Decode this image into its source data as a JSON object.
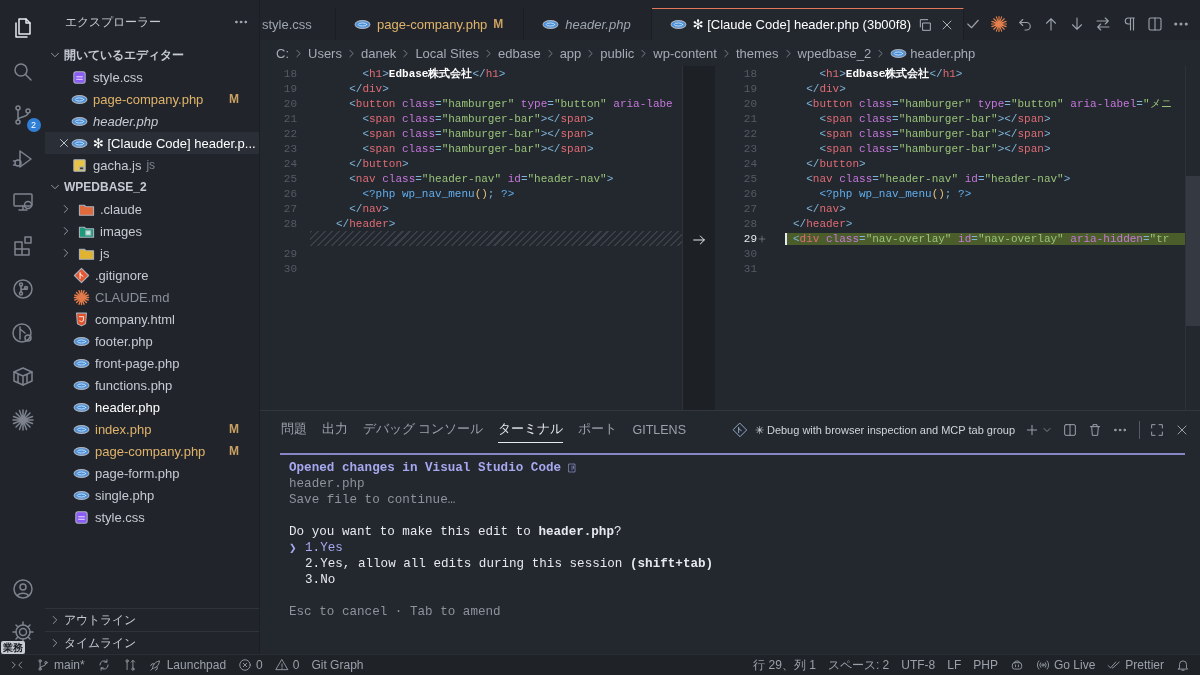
{
  "activity_bar": {
    "items": [
      {
        "kind": "explorer",
        "selected": true
      },
      {
        "kind": "search",
        "selected": false
      },
      {
        "kind": "source-control",
        "selected": false,
        "badge": "2"
      },
      {
        "kind": "run-debug",
        "selected": false
      },
      {
        "kind": "remote",
        "selected": false
      },
      {
        "kind": "extensions",
        "selected": false
      },
      {
        "kind": "git-graph",
        "selected": false
      },
      {
        "kind": "branch-search",
        "selected": false
      },
      {
        "kind": "container",
        "selected": false
      },
      {
        "kind": "claude",
        "selected": false
      }
    ],
    "bottom": [
      {
        "kind": "account",
        "selected": false
      },
      {
        "kind": "settings",
        "selected": false,
        "badge": "業務"
      }
    ]
  },
  "sidebar": {
    "title": "エクスプローラー",
    "sections": [
      {
        "title": "開いているエディター",
        "expanded": true,
        "items": [
          {
            "label": "style.css",
            "kind": "css",
            "selected": false
          },
          {
            "label": "page-company.php",
            "kind": "php",
            "selected": false,
            "modified": true,
            "badge": "M"
          },
          {
            "label": "header.php",
            "kind": "php",
            "selected": false,
            "preview": true
          },
          {
            "label": "✻ [Claude Code] header.p...",
            "kind": "php",
            "selected": true
          },
          {
            "label": "gacha.js",
            "kind": "js",
            "selected": false,
            "description": "js"
          }
        ]
      },
      {
        "title": "WPEDBASE_2",
        "expanded": true,
        "items": [
          {
            "label": ".claude",
            "kind": "claude-folder",
            "selected": false,
            "expanded": false
          },
          {
            "label": "images",
            "kind": "image-folder",
            "selected": false,
            "expanded": false
          },
          {
            "label": "js",
            "kind": "js-folder",
            "selected": false,
            "expanded": false
          },
          {
            "label": ".gitignore",
            "kind": "git",
            "selected": false
          },
          {
            "label": "CLAUDE.md",
            "kind": "claude",
            "selected": false,
            "dimmed": true
          },
          {
            "label": "company.html",
            "kind": "html",
            "selected": false
          },
          {
            "label": "footer.php",
            "kind": "php",
            "selected": false
          },
          {
            "label": "front-page.php",
            "kind": "php",
            "selected": false
          },
          {
            "label": "functions.php",
            "kind": "php",
            "selected": false
          },
          {
            "label": "header.php",
            "kind": "php",
            "selected": true
          },
          {
            "label": "index.php",
            "kind": "php",
            "selected": false,
            "modified": true,
            "badge": "M"
          },
          {
            "label": "page-company.php",
            "kind": "php",
            "selected": false,
            "modified": true,
            "badge": "M"
          },
          {
            "label": "page-form.php",
            "kind": "php",
            "selected": false
          },
          {
            "label": "single.php",
            "kind": "php",
            "selected": false
          },
          {
            "label": "style.css",
            "kind": "css",
            "selected": false
          }
        ]
      }
    ],
    "bottom_sections": [
      {
        "title": "アウトライン",
        "expanded": false
      },
      {
        "title": "タイムライン",
        "expanded": false
      }
    ]
  },
  "tabs": [
    {
      "label": "style.css",
      "kind": "plain",
      "selected": false
    },
    {
      "label": "page-company.php",
      "kind": "php",
      "selected": false,
      "modified": true,
      "badge": "M"
    },
    {
      "label": "header.php",
      "kind": "php",
      "selected": false,
      "preview": true
    },
    {
      "label": "✻ [Claude Code] header.php (3b00f8)",
      "kind": "php",
      "selected": true
    }
  ],
  "breadcrumb": [
    "C:",
    "Users",
    "danek",
    "Local Sites",
    "edbase",
    "app",
    "public",
    "wp-content",
    "themes",
    "wpedbase_2",
    "header.php"
  ],
  "diff": {
    "left": [
      {
        "kind": "code",
        "number": "18",
        "tokens": [
          {
            "kind": "punct",
            "text": "    <"
          },
          {
            "kind": "tag",
            "text": "h1"
          },
          {
            "kind": "punct",
            "text": ">"
          },
          {
            "kind": "content",
            "text": "Edbase株式会社"
          },
          {
            "kind": "punct",
            "text": "</"
          },
          {
            "kind": "tag",
            "text": "h1"
          },
          {
            "kind": "punct",
            "text": ">"
          }
        ]
      },
      {
        "kind": "code",
        "number": "19",
        "tokens": [
          {
            "kind": "punct",
            "text": "  </"
          },
          {
            "kind": "tag",
            "text": "div"
          },
          {
            "kind": "punct",
            "text": ">"
          }
        ]
      },
      {
        "kind": "code",
        "number": "20",
        "tokens": [
          {
            "kind": "punct",
            "text": "  <"
          },
          {
            "kind": "tag",
            "text": "button"
          },
          {
            "kind": "attr",
            "text": " class"
          },
          {
            "kind": "punct",
            "text": "="
          },
          {
            "kind": "string",
            "text": "\"hamburger\""
          },
          {
            "kind": "attr",
            "text": " type"
          },
          {
            "kind": "punct",
            "text": "="
          },
          {
            "kind": "string",
            "text": "\"button\""
          },
          {
            "kind": "attr",
            "text": " aria-labe"
          }
        ]
      },
      {
        "kind": "code",
        "number": "21",
        "tokens": [
          {
            "kind": "punct",
            "text": "    <"
          },
          {
            "kind": "tag",
            "text": "span"
          },
          {
            "kind": "attr",
            "text": " class"
          },
          {
            "kind": "punct",
            "text": "="
          },
          {
            "kind": "string",
            "text": "\"hamburger-bar\""
          },
          {
            "kind": "punct",
            "text": "></"
          },
          {
            "kind": "tag",
            "text": "span"
          },
          {
            "kind": "punct",
            "text": ">"
          }
        ]
      },
      {
        "kind": "code",
        "number": "22",
        "tokens": [
          {
            "kind": "punct",
            "text": "    <"
          },
          {
            "kind": "tag",
            "text": "span"
          },
          {
            "kind": "attr",
            "text": " class"
          },
          {
            "kind": "punct",
            "text": "="
          },
          {
            "kind": "string",
            "text": "\"hamburger-bar\""
          },
          {
            "kind": "punct",
            "text": "></"
          },
          {
            "kind": "tag",
            "text": "span"
          },
          {
            "kind": "punct",
            "text": ">"
          }
        ]
      },
      {
        "kind": "code",
        "number": "23",
        "tokens": [
          {
            "kind": "punct",
            "text": "    <"
          },
          {
            "kind": "tag",
            "text": "span"
          },
          {
            "kind": "attr",
            "text": " class"
          },
          {
            "kind": "punct",
            "text": "="
          },
          {
            "kind": "string",
            "text": "\"hamburger-bar\""
          },
          {
            "kind": "punct",
            "text": "></"
          },
          {
            "kind": "tag",
            "text": "span"
          },
          {
            "kind": "punct",
            "text": ">"
          }
        ]
      },
      {
        "kind": "code",
        "number": "24",
        "tokens": [
          {
            "kind": "punct",
            "text": "  </"
          },
          {
            "kind": "tag",
            "text": "button"
          },
          {
            "kind": "punct",
            "text": ">"
          }
        ]
      },
      {
        "kind": "code",
        "number": "25",
        "tokens": [
          {
            "kind": "punct",
            "text": "  <"
          },
          {
            "kind": "tag",
            "text": "nav"
          },
          {
            "kind": "attr",
            "text": " class"
          },
          {
            "kind": "punct",
            "text": "="
          },
          {
            "kind": "string",
            "text": "\"header-nav\""
          },
          {
            "kind": "attr",
            "text": " id"
          },
          {
            "kind": "punct",
            "text": "="
          },
          {
            "kind": "string",
            "text": "\"header-nav\""
          },
          {
            "kind": "punct",
            "text": ">"
          }
        ]
      },
      {
        "kind": "code",
        "number": "26",
        "tokens": [
          {
            "kind": "php",
            "text": "    <?php"
          },
          {
            "kind": "function",
            "text": " wp_nav_menu"
          },
          {
            "kind": "paren",
            "text": "()"
          },
          {
            "kind": "punct",
            "text": "; "
          },
          {
            "kind": "php",
            "text": "?>"
          }
        ]
      },
      {
        "kind": "code",
        "number": "27",
        "tokens": [
          {
            "kind": "punct",
            "text": "  </"
          },
          {
            "kind": "tag",
            "text": "nav"
          },
          {
            "kind": "punct",
            "text": ">"
          }
        ]
      },
      {
        "kind": "code",
        "number": "28",
        "tokens": [
          {
            "kind": "punct",
            "text": "</"
          },
          {
            "kind": "tag",
            "text": "header"
          },
          {
            "kind": "punct",
            "text": ">"
          }
        ]
      },
      {
        "kind": "filler"
      },
      {
        "kind": "code",
        "number": "29"
      },
      {
        "kind": "code",
        "number": "30"
      }
    ],
    "right": [
      {
        "number": "18",
        "added": false,
        "tokens": [
          {
            "kind": "punct",
            "text": "    <"
          },
          {
            "kind": "tag",
            "text": "h1"
          },
          {
            "kind": "punct",
            "text": ">"
          },
          {
            "kind": "content",
            "text": "Edbase株式会社"
          },
          {
            "kind": "punct",
            "text": "</"
          },
          {
            "kind": "tag",
            "text": "h1"
          },
          {
            "kind": "punct",
            "text": ">"
          }
        ]
      },
      {
        "number": "19",
        "added": false,
        "tokens": [
          {
            "kind": "punct",
            "text": "  </"
          },
          {
            "kind": "tag",
            "text": "div"
          },
          {
            "kind": "punct",
            "text": ">"
          }
        ]
      },
      {
        "number": "20",
        "added": false,
        "tokens": [
          {
            "kind": "punct",
            "text": "  <"
          },
          {
            "kind": "tag",
            "text": "button"
          },
          {
            "kind": "attr",
            "text": " class"
          },
          {
            "kind": "punct",
            "text": "="
          },
          {
            "kind": "string",
            "text": "\"hamburger\""
          },
          {
            "kind": "attr",
            "text": " type"
          },
          {
            "kind": "punct",
            "text": "="
          },
          {
            "kind": "string",
            "text": "\"button\""
          },
          {
            "kind": "attr",
            "text": " aria-label"
          },
          {
            "kind": "punct",
            "text": "="
          },
          {
            "kind": "string",
            "text": "\"メニ"
          }
        ]
      },
      {
        "number": "21",
        "added": false,
        "tokens": [
          {
            "kind": "punct",
            "text": "    <"
          },
          {
            "kind": "tag",
            "text": "span"
          },
          {
            "kind": "attr",
            "text": " class"
          },
          {
            "kind": "punct",
            "text": "="
          },
          {
            "kind": "string",
            "text": "\"hamburger-bar\""
          },
          {
            "kind": "punct",
            "text": "></"
          },
          {
            "kind": "tag",
            "text": "span"
          },
          {
            "kind": "punct",
            "text": ">"
          }
        ]
      },
      {
        "number": "22",
        "added": false,
        "tokens": [
          {
            "kind": "punct",
            "text": "    <"
          },
          {
            "kind": "tag",
            "text": "span"
          },
          {
            "kind": "attr",
            "text": " class"
          },
          {
            "kind": "punct",
            "text": "="
          },
          {
            "kind": "string",
            "text": "\"hamburger-bar\""
          },
          {
            "kind": "punct",
            "text": "></"
          },
          {
            "kind": "tag",
            "text": "span"
          },
          {
            "kind": "punct",
            "text": ">"
          }
        ]
      },
      {
        "number": "23",
        "added": false,
        "tokens": [
          {
            "kind": "punct",
            "text": "    <"
          },
          {
            "kind": "tag",
            "text": "span"
          },
          {
            "kind": "attr",
            "text": " class"
          },
          {
            "kind": "punct",
            "text": "="
          },
          {
            "kind": "string",
            "text": "\"hamburger-bar\""
          },
          {
            "kind": "punct",
            "text": "></"
          },
          {
            "kind": "tag",
            "text": "span"
          },
          {
            "kind": "punct",
            "text": ">"
          }
        ]
      },
      {
        "number": "24",
        "added": false,
        "tokens": [
          {
            "kind": "punct",
            "text": "  </"
          },
          {
            "kind": "tag",
            "text": "button"
          },
          {
            "kind": "punct",
            "text": ">"
          }
        ]
      },
      {
        "number": "25",
        "added": false,
        "tokens": [
          {
            "kind": "punct",
            "text": "  <"
          },
          {
            "kind": "tag",
            "text": "nav"
          },
          {
            "kind": "attr",
            "text": " class"
          },
          {
            "kind": "punct",
            "text": "="
          },
          {
            "kind": "string",
            "text": "\"header-nav\""
          },
          {
            "kind": "attr",
            "text": " id"
          },
          {
            "kind": "punct",
            "text": "="
          },
          {
            "kind": "string",
            "text": "\"header-nav\""
          },
          {
            "kind": "punct",
            "text": ">"
          }
        ]
      },
      {
        "number": "26",
        "added": false,
        "tokens": [
          {
            "kind": "php",
            "text": "    <?php"
          },
          {
            "kind": "function",
            "text": " wp_nav_menu"
          },
          {
            "kind": "paren",
            "text": "()"
          },
          {
            "kind": "punct",
            "text": "; "
          },
          {
            "kind": "php",
            "text": "?>"
          }
        ]
      },
      {
        "number": "27",
        "added": false,
        "tokens": [
          {
            "kind": "punct",
            "text": "  </"
          },
          {
            "kind": "tag",
            "text": "nav"
          },
          {
            "kind": "punct",
            "text": ">"
          }
        ]
      },
      {
        "number": "28",
        "added": false,
        "tokens": [
          {
            "kind": "punct",
            "text": "</"
          },
          {
            "kind": "tag",
            "text": "header"
          },
          {
            "kind": "punct",
            "text": ">"
          }
        ]
      },
      {
        "number": "29",
        "added": true,
        "tokens": [
          {
            "kind": "punct",
            "text": "<"
          },
          {
            "kind": "tag",
            "text": "div"
          },
          {
            "kind": "attr",
            "text": " class"
          },
          {
            "kind": "punct",
            "text": "="
          },
          {
            "kind": "string",
            "text": "\"nav-overlay\""
          },
          {
            "kind": "attr",
            "text": " id"
          },
          {
            "kind": "punct",
            "text": "="
          },
          {
            "kind": "string",
            "text": "\"nav-overlay\""
          },
          {
            "kind": "attr",
            "text": " aria-hidden"
          },
          {
            "kind": "punct",
            "text": "="
          },
          {
            "kind": "string",
            "text": "\"tr"
          }
        ]
      },
      {
        "number": "30",
        "added": false
      },
      {
        "number": "31",
        "added": false
      }
    ]
  },
  "panel": {
    "tabs": [
      {
        "label": "問題",
        "selected": false
      },
      {
        "label": "出力",
        "selected": false
      },
      {
        "label": "デバッグ コンソール",
        "selected": false
      },
      {
        "label": "ターミナル",
        "selected": true
      },
      {
        "label": "ポート",
        "selected": false
      },
      {
        "label": "GITLENS",
        "selected": false
      }
    ],
    "terminal_name": "✳ Debug with browser inspection and MCP tab group",
    "terminal": {
      "cursor": "❯",
      "lines": [
        {
          "kind": "heading",
          "text": "Opened changes in Visual Studio Code"
        },
        {
          "kind": "dim",
          "text": "header.php"
        },
        {
          "kind": "dim",
          "text": "Save file to continue…"
        },
        {
          "kind": "blank"
        },
        {
          "kind": "normal",
          "text": "Do you want to make this edit to **header.php**?"
        },
        {
          "kind": "option",
          "number": "1.",
          "text": "Yes",
          "selected": true
        },
        {
          "kind": "option",
          "number": "2.",
          "text": "Yes, allow all edits during this session **(shift+tab)**",
          "selected": false
        },
        {
          "kind": "option",
          "number": "3.",
          "text": "No",
          "selected": false
        },
        {
          "kind": "blank"
        },
        {
          "kind": "dim",
          "text": "Esc to cancel · Tab to amend"
        }
      ]
    }
  },
  "status_bar": {
    "left": [
      {
        "kind": "remote"
      },
      {
        "kind": "branch",
        "text": "main*"
      },
      {
        "kind": "sync"
      },
      {
        "kind": "compare"
      },
      {
        "kind": "launchpad",
        "text": "Launchpad"
      },
      {
        "kind": "errors",
        "text": "0"
      },
      {
        "kind": "warnings",
        "text": "0"
      },
      {
        "kind": "text",
        "text": "Git Graph"
      }
    ],
    "right": [
      {
        "kind": "text",
        "text": "行 29、列 1"
      },
      {
        "kind": "text",
        "text": "スペース: 2"
      },
      {
        "kind": "text",
        "text": "UTF-8"
      },
      {
        "kind": "text",
        "text": "LF"
      },
      {
        "kind": "text",
        "text": "PHP"
      },
      {
        "kind": "copilot"
      },
      {
        "kind": "golive",
        "text": "Go Live"
      },
      {
        "kind": "prettier",
        "text": "Prettier"
      },
      {
        "kind": "bell"
      }
    ]
  }
}
